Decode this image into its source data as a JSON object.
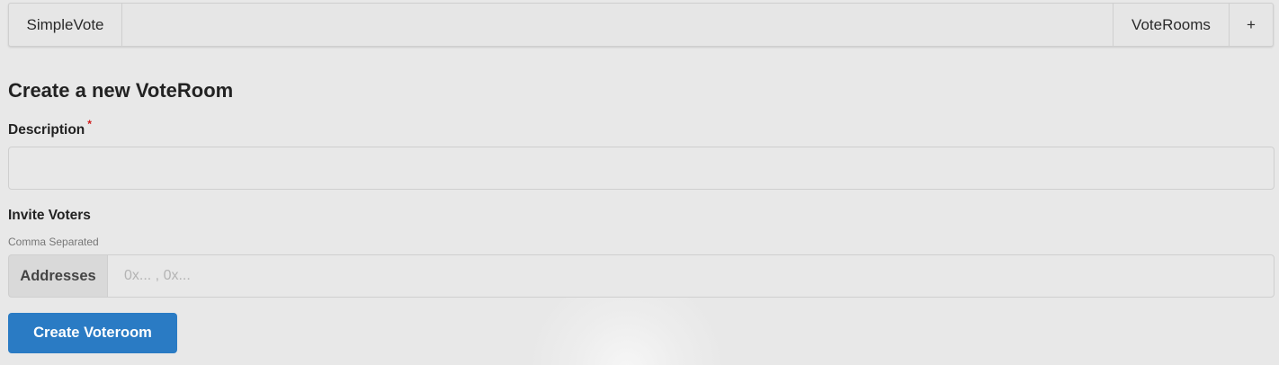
{
  "navbar": {
    "brand": "SimpleVote",
    "voterooms": "VoteRooms",
    "add": "+"
  },
  "form": {
    "title": "Create a new VoteRoom",
    "description_label": "Description",
    "required_mark": "*",
    "description_value": "",
    "invite_label": "Invite Voters",
    "invite_hint": "Comma Separated",
    "addresses_label": "Addresses",
    "addresses_placeholder": "0x... , 0x...",
    "addresses_value": "",
    "submit_label": "Create Voteroom"
  },
  "colors": {
    "primary_button": "#2a7bc4",
    "required": "#d01919",
    "background": "#e8e8e8"
  }
}
